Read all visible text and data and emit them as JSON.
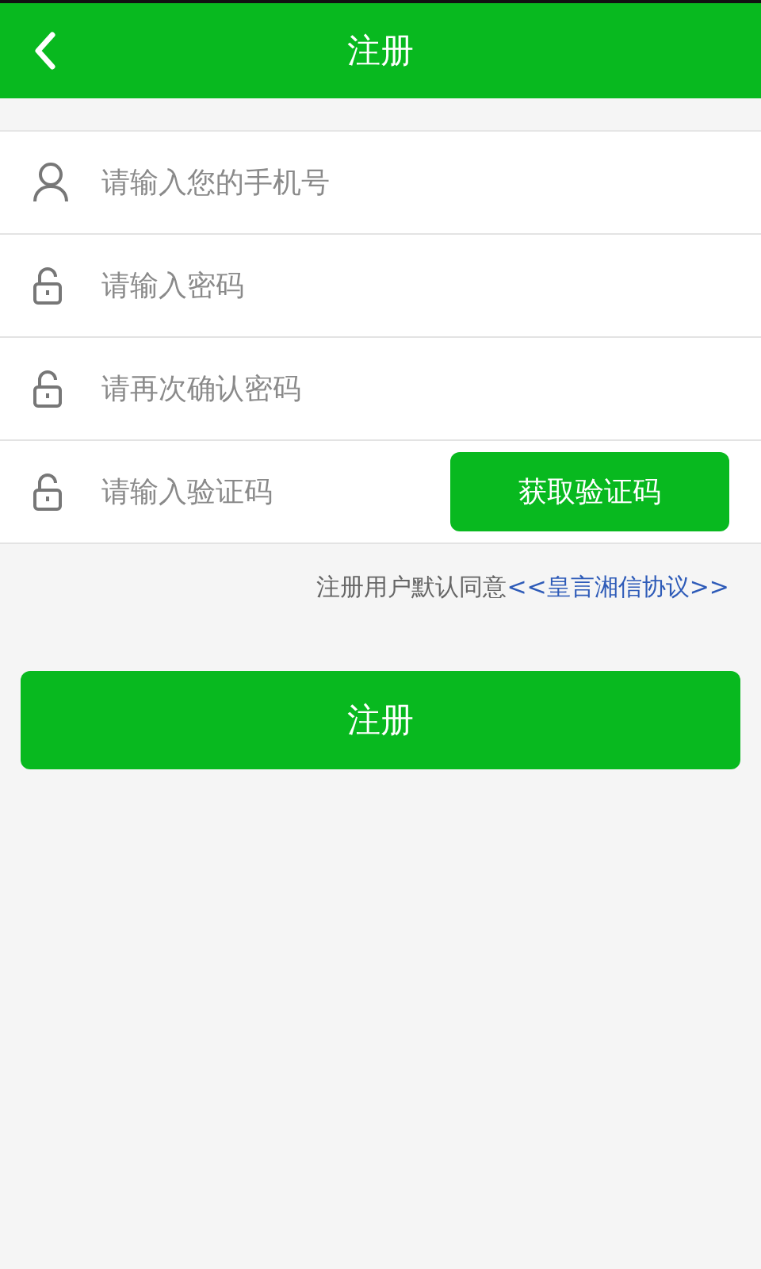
{
  "header": {
    "title": "注册"
  },
  "fields": [
    {
      "kind": "phone",
      "placeholder": "请输入您的手机号"
    },
    {
      "kind": "password",
      "placeholder": "请输入密码"
    },
    {
      "kind": "password",
      "placeholder": "请再次确认密码"
    },
    {
      "kind": "code",
      "placeholder": "请输入验证码",
      "button": "获取验证码"
    }
  ],
  "agreement": {
    "text": "注册用户默认同意",
    "link": "<<皇言湘信协议>>"
  },
  "submit": "注册"
}
